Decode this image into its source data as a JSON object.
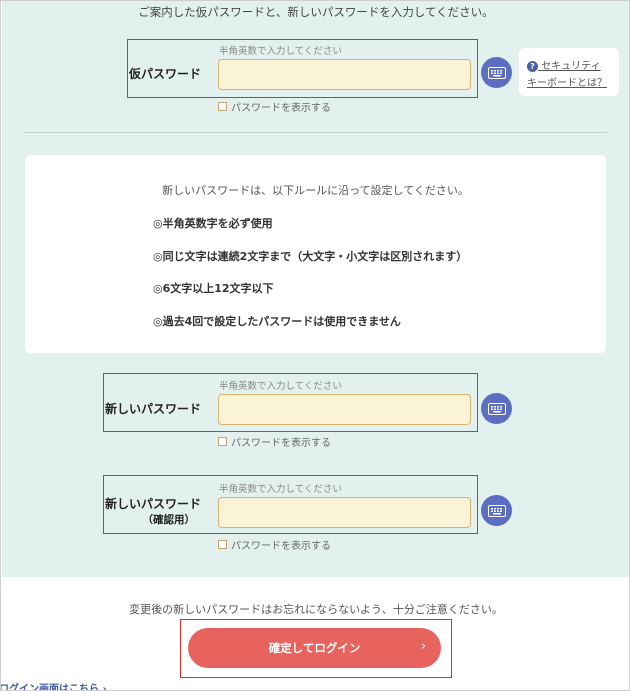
{
  "intro": "ご案内した仮パスワードと、新しいパスワードを入力してください。",
  "temp_password": {
    "label": "仮パスワード",
    "hint": "半角英数で入力してください",
    "value": "",
    "show_label": "パスワードを表示する",
    "keyboard_icon": "keyboard-icon"
  },
  "security_keyboard": {
    "help_icon": "?",
    "line1": "セキュリティ",
    "line2": "キーボードとは？"
  },
  "rules": {
    "intro": "新しいパスワードは、以下ルールに沿って設定してください。",
    "items": [
      "◎半角英数字を必ず使用",
      "◎同じ文字は連続2文字まで（大文字・小文字は区別されます）",
      "◎6文字以上12文字以下",
      "◎過去4回で設定したパスワードは使用できません"
    ]
  },
  "new_password": {
    "label": "新しいパスワード",
    "hint": "半角英数で入力してください",
    "value": "",
    "show_label": "パスワードを表示する"
  },
  "confirm_password": {
    "label": "新しいパスワード",
    "sublabel": "（確認用）",
    "hint": "半角英数で入力してください",
    "value": "",
    "show_label": "パスワードを表示する"
  },
  "warning": "変更後の新しいパスワードはお忘れにならないよう、十分ご注意ください。",
  "submit": {
    "label": "確定してログイン",
    "chevron": "›"
  },
  "login_link": "ログイン画面はこちら ›",
  "colors": {
    "background": "#e3f1ee",
    "input_fill": "#fbf3d7",
    "keyboard_button": "#5b6ec2",
    "highlight_box": "#d9302b",
    "submit_button": "#e8625e"
  }
}
